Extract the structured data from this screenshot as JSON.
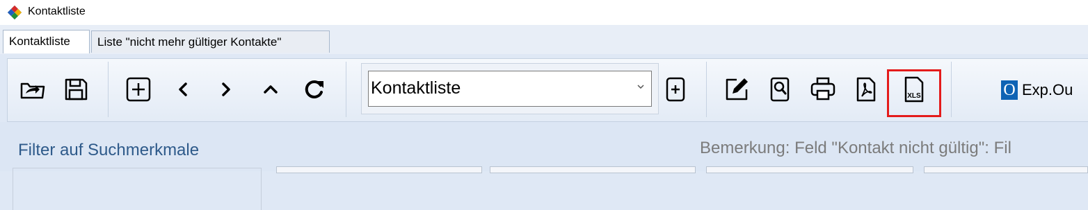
{
  "window": {
    "title": "Kontaktliste",
    "icon": "app-diamond-icon"
  },
  "tabs": [
    {
      "label": "Kontaktliste",
      "active": true
    },
    {
      "label": "Liste \"nicht mehr gültiger Kontakte\"",
      "active": false
    }
  ],
  "toolbar": {
    "buttons": [
      {
        "name": "open-folder-button",
        "icon": "folder-open-icon"
      },
      {
        "name": "save-button",
        "icon": "floppy-disk-icon"
      },
      {
        "name": "add-record-button",
        "icon": "plus-square-icon"
      },
      {
        "name": "previous-button",
        "icon": "chevron-left-icon"
      },
      {
        "name": "next-button",
        "icon": "chevron-right-icon"
      },
      {
        "name": "up-button",
        "icon": "chevron-up-icon"
      },
      {
        "name": "refresh-button",
        "icon": "refresh-icon"
      },
      {
        "name": "add-list-button",
        "icon": "plus-small-icon"
      },
      {
        "name": "edit-button",
        "icon": "pencil-icon"
      },
      {
        "name": "search-document-button",
        "icon": "magnifier-document-icon"
      },
      {
        "name": "print-button",
        "icon": "printer-icon"
      },
      {
        "name": "pdf-export-button",
        "icon": "pdf-icon"
      },
      {
        "name": "xls-export-button",
        "icon": "xls-file-icon",
        "highlighted": true
      }
    ],
    "list_select": {
      "value": "Kontaktliste"
    },
    "xls_label": "XLS",
    "outlook": {
      "logo": "O",
      "label": "Exp.Ou"
    },
    "highlight_color": "#e41b1b"
  },
  "filter": {
    "group_title": "Filter auf Suchmerkmale"
  },
  "remark": {
    "text": "Bemerkung: Feld \"Kontakt nicht gültig\": Fil"
  },
  "colors": {
    "accent": "#2e5a8a",
    "outlook_blue": "#0f63b4"
  }
}
